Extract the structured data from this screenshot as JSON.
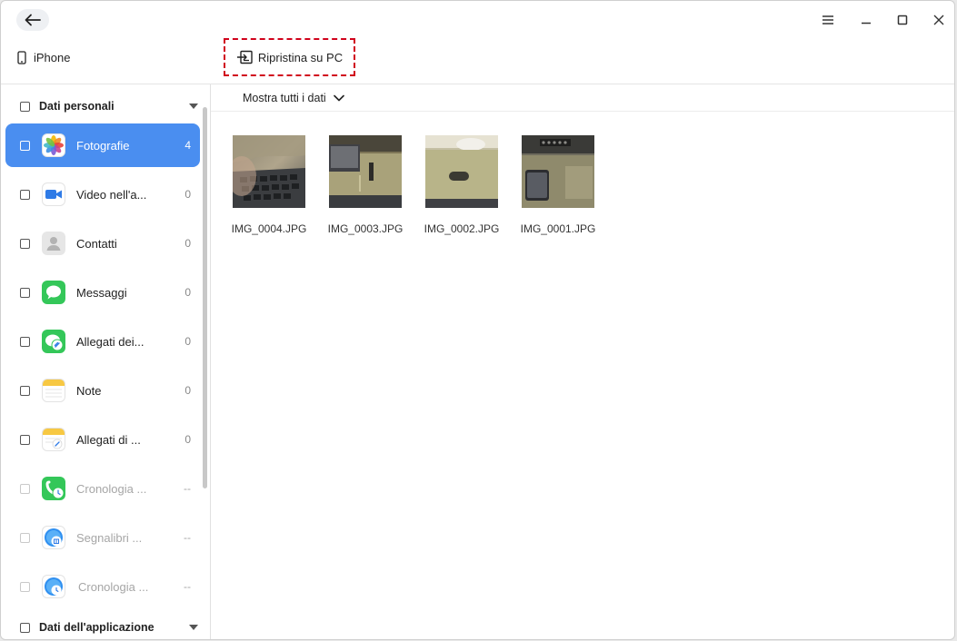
{
  "titlebar": {
    "back_icon": "arrow-left-icon",
    "menu_icon": "hamburger-icon",
    "minimize_icon": "minimize-icon",
    "maximize_icon": "maximize-icon",
    "close_icon": "close-icon"
  },
  "toolbar": {
    "device_label": "iPhone",
    "device_icon": "phone-icon",
    "restore_label": "Ripristina su PC",
    "restore_icon": "restore-to-pc-icon",
    "restore_highlight_color": "#d0021b"
  },
  "sidebar": {
    "personal_section": "Dati personali",
    "app_section": "Dati dell'applicazione",
    "accent_color": "#4a8ef0",
    "items": [
      {
        "label": "Fotografie",
        "count": "4",
        "icon": "photos-icon"
      },
      {
        "label": "Video nell'a...",
        "count": "0",
        "icon": "video-icon"
      },
      {
        "label": "Contatti",
        "count": "0",
        "icon": "contacts-icon"
      },
      {
        "label": "Messaggi",
        "count": "0",
        "icon": "messages-icon"
      },
      {
        "label": "Allegati dei...",
        "count": "0",
        "icon": "message-attachments-icon"
      },
      {
        "label": "Note",
        "count": "0",
        "icon": "notes-icon"
      },
      {
        "label": "Allegati di ...",
        "count": "0",
        "icon": "note-attachments-icon"
      },
      {
        "label": "Cronologia ...",
        "count": "--",
        "icon": "call-history-icon"
      },
      {
        "label": "Segnalibri ...",
        "count": "--",
        "icon": "safari-bookmarks-icon"
      },
      {
        "label": "Cronologia ...",
        "count": "--",
        "icon": "safari-history-icon"
      }
    ]
  },
  "main": {
    "filter_label": "Mostra tutti i dati",
    "photos": [
      {
        "name": "IMG_0004.JPG"
      },
      {
        "name": "IMG_0003.JPG"
      },
      {
        "name": "IMG_0002.JPG"
      },
      {
        "name": "IMG_0001.JPG"
      }
    ]
  }
}
